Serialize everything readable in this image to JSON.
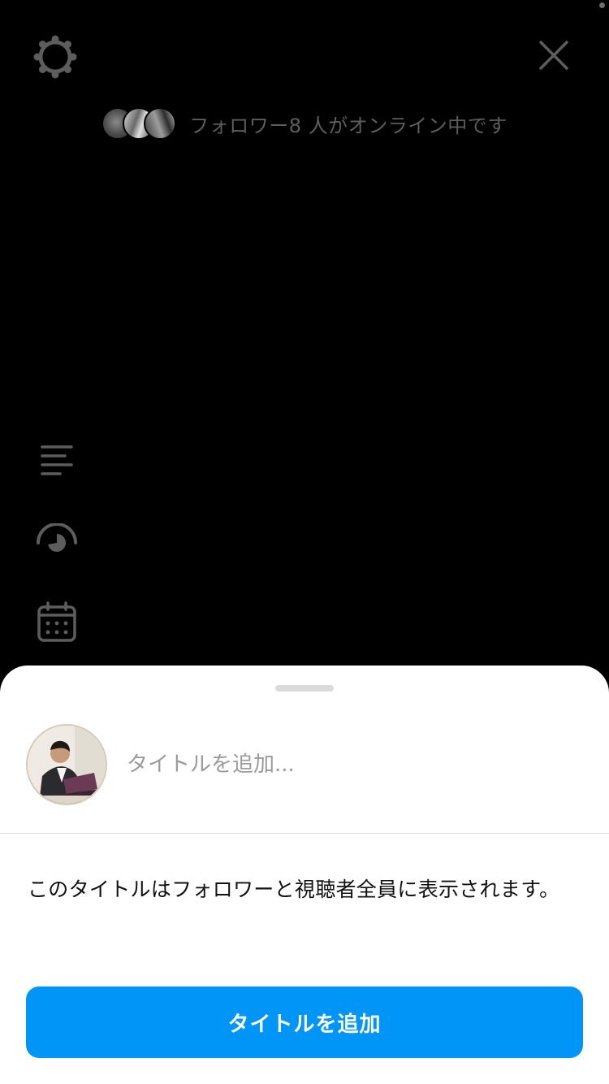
{
  "top_bar": {
    "settings_icon": "gear-icon",
    "close_icon": "close-icon"
  },
  "online_indicator": {
    "text": "フォロワー8 人がオンライン中です",
    "avatar_count": 3
  },
  "side_tools": [
    {
      "icon": "text-align-left-icon"
    },
    {
      "icon": "audience-eye-icon"
    },
    {
      "icon": "calendar-icon"
    }
  ],
  "title_sheet": {
    "input_value": "",
    "input_placeholder": "タイトルを追加...",
    "info_text": "このタイトルはフォロワーと視聴者全員に表示されます。",
    "button_label": "タイトルを追加"
  },
  "colors": {
    "background": "#000000",
    "sheet_background": "#ffffff",
    "primary_button": "#0095f6",
    "icon_gray": "#5d5d5d"
  }
}
